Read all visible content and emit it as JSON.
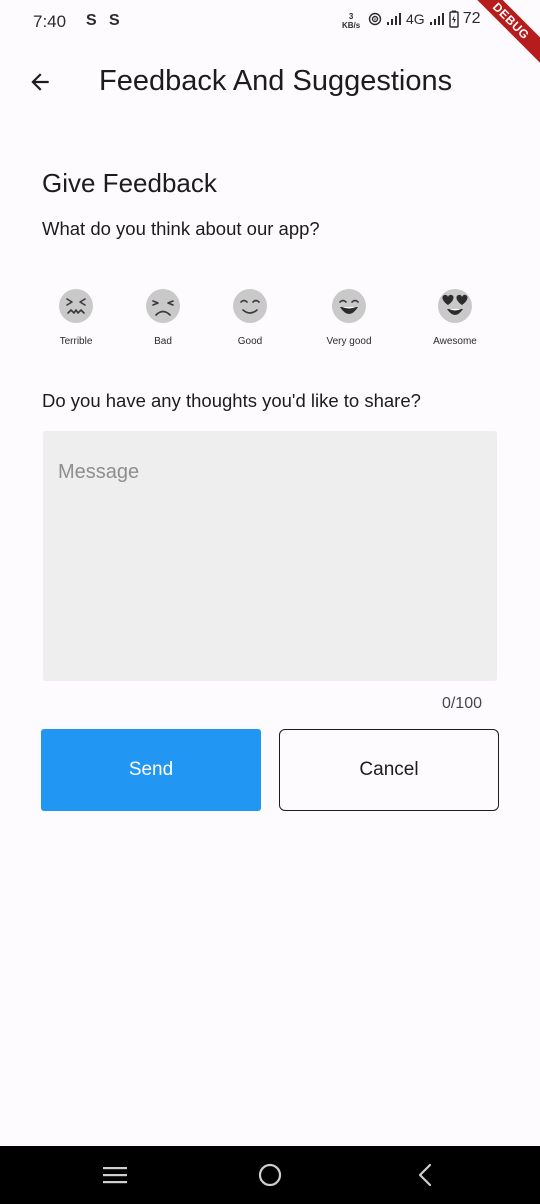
{
  "status_bar": {
    "time": "7:40",
    "sim_icon_1": "S",
    "sim_icon_2": "S",
    "speed_value": "3",
    "speed_unit": "KB/s",
    "network_label": "4G",
    "battery_percent": "72",
    "icons": [
      "hotspot-icon",
      "signal-icon",
      "signal-icon",
      "battery-icon"
    ]
  },
  "debug_banner": "DEBUG",
  "app_bar": {
    "back_icon": "arrow-back-icon",
    "title": "Feedback And Suggestions"
  },
  "feedback": {
    "title": "Give Feedback",
    "question": "What do you think about our app?",
    "ratings": [
      {
        "label": "Terrible",
        "icon": "face-terrible-icon"
      },
      {
        "label": "Bad",
        "icon": "face-bad-icon"
      },
      {
        "label": "Good",
        "icon": "face-good-icon"
      },
      {
        "label": "Very good",
        "icon": "face-very-good-icon"
      },
      {
        "label": "Awesome",
        "icon": "face-awesome-icon"
      }
    ],
    "thoughts_question": "Do you have any thoughts you'd like to share?",
    "message_placeholder": "Message",
    "message_value": "",
    "counter": "0/100"
  },
  "actions": {
    "send_label": "Send",
    "cancel_label": "Cancel"
  },
  "colors": {
    "accent": "#2196f3",
    "background": "#fefbfe",
    "face_fill": "#c9c9c9",
    "face_stroke": "#3a3a3a"
  },
  "nav_bar": {
    "icons": [
      "menu-icon",
      "home-icon",
      "back-nav-icon"
    ]
  }
}
